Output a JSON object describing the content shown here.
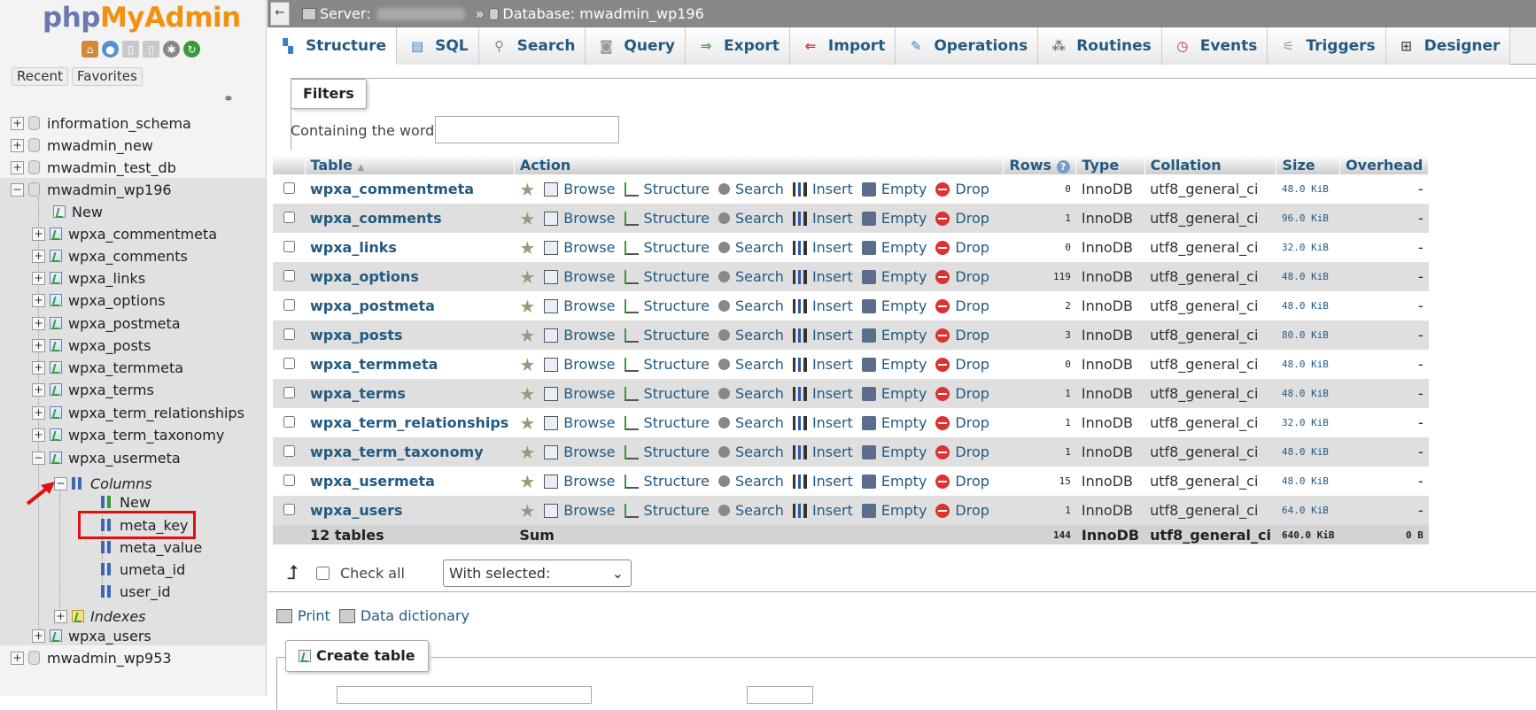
{
  "nav": {
    "logo_part1": "php",
    "logo_part2": "MyAdmin",
    "recent_tab": "Recent",
    "favorites_tab": "Favorites",
    "databases": [
      "information_schema",
      "mwadmin_new",
      "mwadmin_test_db",
      "mwadmin_wp196"
    ],
    "wp196_new": "New",
    "wp196_tables": [
      "wpxa_commentmeta",
      "wpxa_comments",
      "wpxa_links",
      "wpxa_options",
      "wpxa_postmeta",
      "wpxa_posts",
      "wpxa_termmeta",
      "wpxa_terms",
      "wpxa_term_relationships",
      "wpxa_term_taxonomy",
      "wpxa_usermeta"
    ],
    "columns_label": "Columns",
    "columns_new": "New",
    "columns": [
      "meta_key",
      "meta_value",
      "umeta_id",
      "user_id"
    ],
    "indexes_label": "Indexes",
    "wpxa_users": "wpxa_users",
    "last_db": "mwadmin_wp953"
  },
  "breadcrumb": {
    "server_label": "Server:",
    "separator": "»",
    "database_label": "Database: mwadmin_wp196"
  },
  "tabs": [
    "Structure",
    "SQL",
    "Search",
    "Query",
    "Export",
    "Import",
    "Operations",
    "Routines",
    "Events",
    "Triggers",
    "Designer"
  ],
  "filters": {
    "legend": "Filters",
    "containing_label": "Containing the word:",
    "input_value": ""
  },
  "table": {
    "headers": {
      "table": "Table",
      "action": "Action",
      "rows": "Rows",
      "type": "Type",
      "collation": "Collation",
      "size": "Size",
      "overhead": "Overhead"
    },
    "actions": [
      "Browse",
      "Structure",
      "Search",
      "Insert",
      "Empty",
      "Drop"
    ],
    "rows": [
      {
        "name": "wpxa_commentmeta",
        "rows": "0",
        "type": "InnoDB",
        "collation": "utf8_general_ci",
        "size": "48.0 KiB",
        "overhead": "-"
      },
      {
        "name": "wpxa_comments",
        "rows": "1",
        "type": "InnoDB",
        "collation": "utf8_general_ci",
        "size": "96.0 KiB",
        "overhead": "-"
      },
      {
        "name": "wpxa_links",
        "rows": "0",
        "type": "InnoDB",
        "collation": "utf8_general_ci",
        "size": "32.0 KiB",
        "overhead": "-"
      },
      {
        "name": "wpxa_options",
        "rows": "119",
        "type": "InnoDB",
        "collation": "utf8_general_ci",
        "size": "48.0 KiB",
        "overhead": "-"
      },
      {
        "name": "wpxa_postmeta",
        "rows": "2",
        "type": "InnoDB",
        "collation": "utf8_general_ci",
        "size": "48.0 KiB",
        "overhead": "-"
      },
      {
        "name": "wpxa_posts",
        "rows": "3",
        "type": "InnoDB",
        "collation": "utf8_general_ci",
        "size": "80.0 KiB",
        "overhead": "-"
      },
      {
        "name": "wpxa_termmeta",
        "rows": "0",
        "type": "InnoDB",
        "collation": "utf8_general_ci",
        "size": "48.0 KiB",
        "overhead": "-"
      },
      {
        "name": "wpxa_terms",
        "rows": "1",
        "type": "InnoDB",
        "collation": "utf8_general_ci",
        "size": "48.0 KiB",
        "overhead": "-"
      },
      {
        "name": "wpxa_term_relationships",
        "rows": "1",
        "type": "InnoDB",
        "collation": "utf8_general_ci",
        "size": "32.0 KiB",
        "overhead": "-"
      },
      {
        "name": "wpxa_term_taxonomy",
        "rows": "1",
        "type": "InnoDB",
        "collation": "utf8_general_ci",
        "size": "48.0 KiB",
        "overhead": "-"
      },
      {
        "name": "wpxa_usermeta",
        "rows": "15",
        "type": "InnoDB",
        "collation": "utf8_general_ci",
        "size": "48.0 KiB",
        "overhead": "-"
      },
      {
        "name": "wpxa_users",
        "rows": "1",
        "type": "InnoDB",
        "collation": "utf8_general_ci",
        "size": "64.0 KiB",
        "overhead": "-"
      }
    ],
    "footer": {
      "count": "12 tables",
      "sum": "Sum",
      "rows": "144",
      "type": "InnoDB",
      "collation": "utf8_general_ci",
      "size": "640.0 KiB",
      "overhead": "0 B"
    }
  },
  "bulk": {
    "check_all": "Check all",
    "with_selected": "With selected:"
  },
  "links": {
    "print": "Print",
    "data_dictionary": "Data dictionary"
  },
  "create_table": {
    "legend": "Create table"
  },
  "colors": {
    "link_blue": "#235a81",
    "highlight_red": "#e21010",
    "logo_php": "#6c78af",
    "logo_myadmin": "#f29111"
  }
}
